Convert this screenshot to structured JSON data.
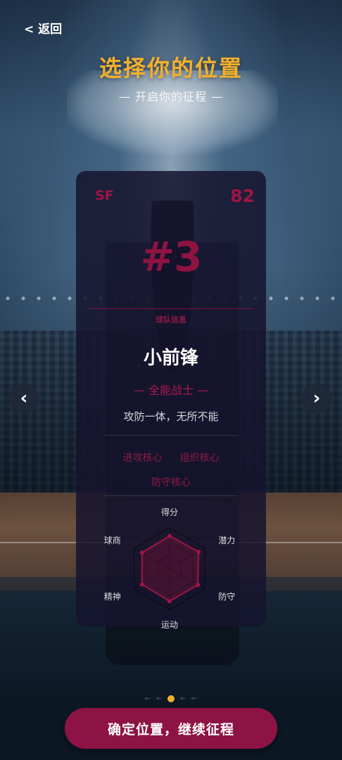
{
  "header": {
    "back_label": "< 返回",
    "title": "选择你的位置",
    "subtitle": "— 开启你的征程 —"
  },
  "card": {
    "position_code": "SF",
    "rating": "82",
    "number": "#3",
    "team_label": "球队信息",
    "position_name": "小前锋",
    "tagline": "— 全能战士 —",
    "description": "攻防一体，无所不能",
    "tags": [
      "进攻核心",
      "组织核心",
      "防守核心"
    ],
    "radar": {
      "axes": [
        "得分",
        "潜力",
        "防守",
        "运动",
        "精神",
        "球商"
      ],
      "values": [
        0.8,
        0.82,
        0.8,
        0.8,
        0.78,
        0.78
      ],
      "accent_color": "#9e1545"
    }
  },
  "navigation": {
    "prev_icon": "‹",
    "next_icon": "›"
  },
  "pagination": {
    "dots": [
      "⟜",
      "⟜",
      "●",
      "⟜",
      "⟜"
    ],
    "active_index": 2
  },
  "footer": {
    "confirm_label": "确定位置，继续征程"
  },
  "colors": {
    "accent": "#9e1545",
    "title_gold": "#f3b02c",
    "card_bg": "#16142e"
  }
}
